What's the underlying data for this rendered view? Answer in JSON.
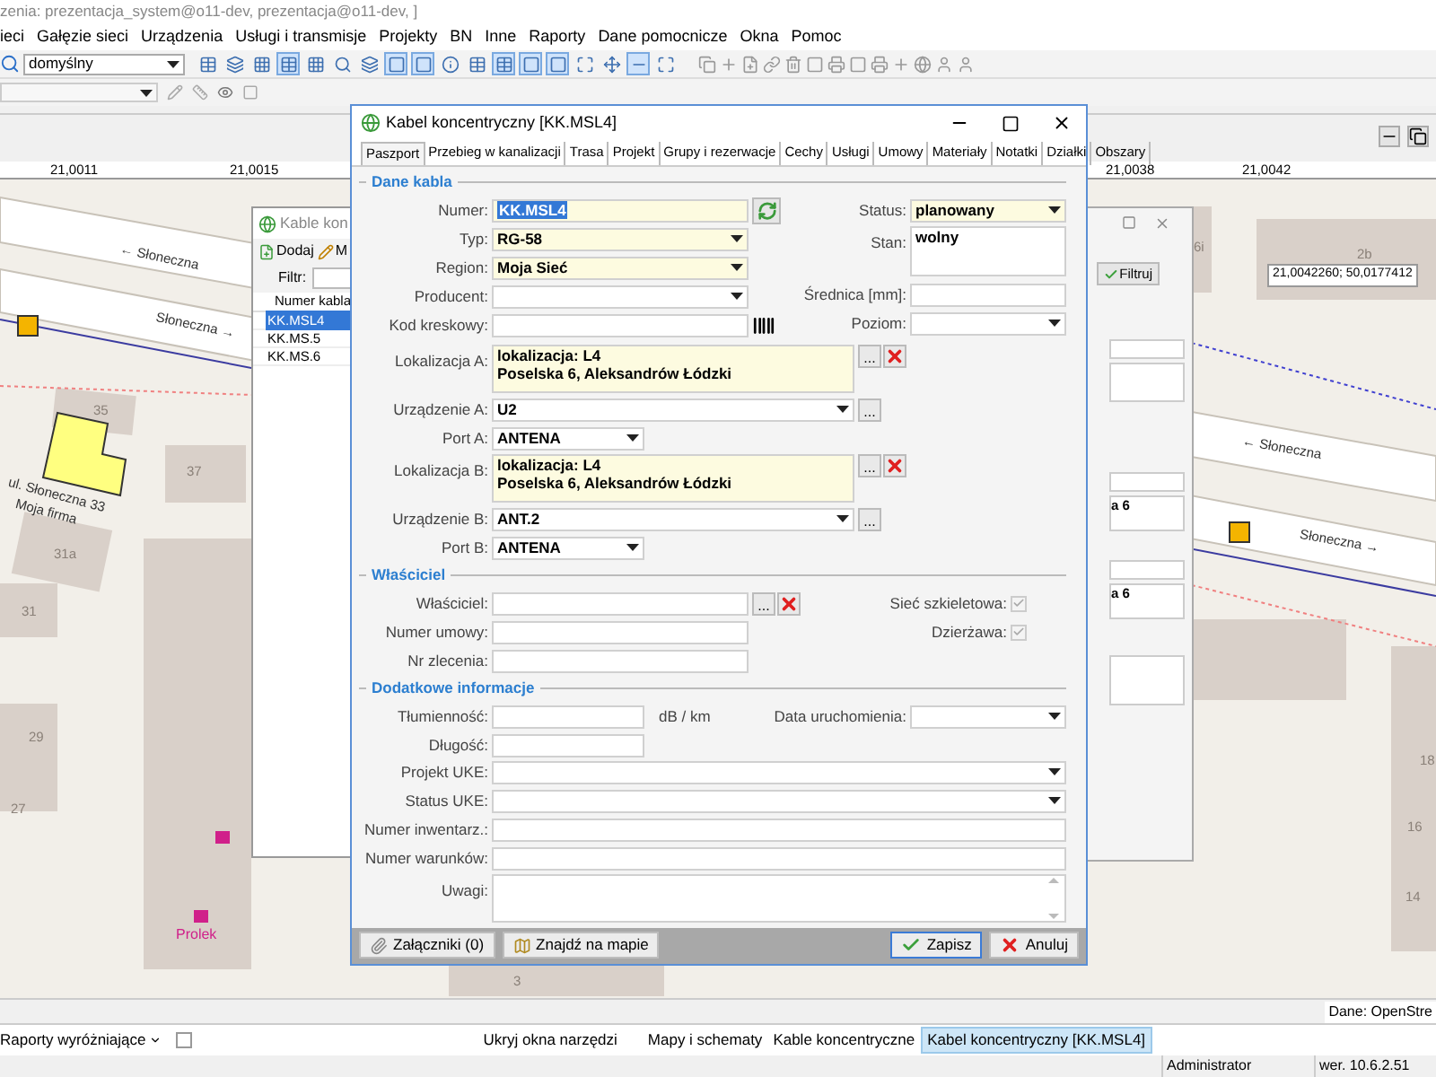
{
  "app_title": "zenia: prezentacja_system@o11-dev, prezentacja@o11-dev, ]",
  "menu": [
    "ieci",
    "Gałęzie sieci",
    "Urządzenia",
    "Usługi i transmisje",
    "Projekty",
    "BN",
    "Inne",
    "Raporty",
    "Dane pomocnicze",
    "Okna",
    "Pomoc"
  ],
  "toolbar": {
    "combo": "domyślny",
    "buttons": [
      {
        "selected": false
      },
      {
        "selected": false
      },
      {
        "selected": false
      },
      {
        "selected": true
      },
      {
        "selected": false
      },
      {
        "selected": false
      },
      {
        "selected": false
      },
      {
        "selected": true
      },
      {
        "selected": true
      },
      {
        "selected": false
      },
      {
        "selected": false
      },
      {
        "selected": true
      },
      {
        "selected": true
      },
      {
        "selected": true
      },
      {
        "selected": false
      },
      {
        "selected": false
      },
      {
        "selected": true
      },
      {
        "selected": false
      }
    ]
  },
  "ruler": [
    "21,0011",
    "21,0015",
    "21,0038",
    "21,0042"
  ],
  "map_labels": [
    {
      "text": "← Słoneczna",
      "kind": "street"
    },
    {
      "text": "Słoneczna →",
      "kind": "street"
    },
    {
      "text": "ul. Słoneczna 33",
      "kind": "address"
    },
    {
      "text": "Moja firma",
      "kind": "address"
    },
    {
      "text": "35",
      "kind": "building"
    },
    {
      "text": "37",
      "kind": "building"
    },
    {
      "text": "31a",
      "kind": "building"
    },
    {
      "text": "31",
      "kind": "building"
    },
    {
      "text": "29",
      "kind": "building"
    },
    {
      "text": "27",
      "kind": "building"
    },
    {
      "text": "Prolek",
      "kind": "poi"
    },
    {
      "text": "3",
      "kind": "building"
    },
    {
      "text": "6i",
      "kind": "building"
    },
    {
      "text": "2b",
      "kind": "building"
    },
    {
      "text": "← Słoneczna",
      "kind": "street"
    },
    {
      "text": "Słoneczna →",
      "kind": "street"
    },
    {
      "text": "18",
      "kind": "building"
    },
    {
      "text": "16",
      "kind": "building"
    },
    {
      "text": "14",
      "kind": "building"
    }
  ],
  "coordinates_tooltip": "21,0042260; 50,0177412",
  "cable_list_window": {
    "title": "Kable kon",
    "buttons": [
      "Dodaj",
      "M"
    ],
    "filter_label": "Filtr:",
    "column": "Numer kabla",
    "rows": [
      {
        "text": "KK.MSL4",
        "selected": true
      },
      {
        "text": "KK.MS.5",
        "selected": false
      },
      {
        "text": "KK.MS.6",
        "selected": false
      }
    ]
  },
  "detail_window": {
    "filter_button": "Filtruj",
    "texts": [
      "a 6",
      "a 6"
    ]
  },
  "dialog": {
    "title": "Kabel koncentryczny [KK.MSL4]",
    "tabs": [
      {
        "label": "Paszport",
        "selected": true
      },
      {
        "label": "Przebieg w kanalizacji",
        "selected": false
      },
      {
        "label": "Trasa",
        "selected": false
      },
      {
        "label": "Projekt",
        "selected": false
      },
      {
        "label": "Grupy i rezerwacje",
        "selected": false
      },
      {
        "label": "Cechy",
        "selected": false
      },
      {
        "label": "Usługi",
        "selected": false
      },
      {
        "label": "Umowy",
        "selected": false
      },
      {
        "label": "Materiały",
        "selected": false
      },
      {
        "label": "Notatki",
        "selected": false
      },
      {
        "label": "Działki",
        "selected": false
      },
      {
        "label": "Obszary",
        "selected": false
      }
    ],
    "sections": [
      {
        "title": "Dane kabla",
        "left": [
          {
            "label": "Numer:",
            "kind": "text",
            "value": "KK.MSL4",
            "required": true,
            "highlighted": true,
            "actions": [
              {
                "kind": "refresh"
              }
            ]
          },
          {
            "label": "Typ:",
            "kind": "combo",
            "value": "RG-58",
            "required": true
          },
          {
            "label": "Region:",
            "kind": "combo",
            "value": "Moja Sieć",
            "required": true
          },
          {
            "label": "Producent:",
            "kind": "combo",
            "required": false
          },
          {
            "label": "Kod kreskowy:",
            "kind": "text",
            "required": false,
            "actions": [
              {
                "kind": "barcode"
              }
            ]
          }
        ],
        "right": [
          {
            "label": "Status:",
            "kind": "combo",
            "value": "planowany",
            "required": true
          },
          {
            "label": "Stan:",
            "kind": "memo",
            "value": "wolny",
            "required": false
          },
          {
            "label": "Średnica [mm]:",
            "kind": "text",
            "required": false
          },
          {
            "label": "Poziom:",
            "kind": "combo",
            "required": false
          }
        ],
        "rows": [
          {
            "label": "Lokalizacja A:",
            "kind": "wide-memo",
            "value": "lokalizacja: L4\nPoselska 6, Aleksandrów Łódzki",
            "required": true,
            "actions": [
              {
                "kind": "browse",
                "label": "..."
              },
              {
                "kind": "clear"
              }
            ]
          },
          {
            "label": "Urządzenie A:",
            "kind": "wide-combo",
            "value": "U2",
            "required": false,
            "actions": [
              {
                "kind": "browse",
                "label": "..."
              }
            ]
          },
          {
            "label": "Port A:",
            "kind": "short-combo",
            "value": "ANTENA",
            "required": false
          },
          {
            "label": "Lokalizacja B:",
            "kind": "wide-memo",
            "value": "lokalizacja: L4\nPoselska 6, Aleksandrów Łódzki",
            "required": true,
            "actions": [
              {
                "kind": "browse",
                "label": "..."
              },
              {
                "kind": "clear"
              }
            ]
          },
          {
            "label": "Urządzenie B:",
            "kind": "wide-combo",
            "value": "ANT.2",
            "required": false,
            "actions": [
              {
                "kind": "browse",
                "label": "..."
              }
            ]
          },
          {
            "label": "Port B:",
            "kind": "short-combo",
            "value": "ANTENA",
            "required": false
          }
        ]
      },
      {
        "title": "Właściciel",
        "left": [
          {
            "label": "Właściciel:",
            "kind": "text",
            "required": false,
            "actions": [
              {
                "kind": "browse",
                "label": "..."
              },
              {
                "kind": "clear"
              }
            ]
          },
          {
            "label": "Numer umowy:",
            "kind": "text",
            "required": false
          },
          {
            "label": "Nr zlecenia:",
            "kind": "text",
            "required": false
          }
        ],
        "right": [
          {
            "label": "Sieć szkieletowa:",
            "kind": "check",
            "checked": true,
            "disabled": true
          },
          {
            "label": "Dzierżawa:",
            "kind": "check",
            "checked": true,
            "disabled": true
          }
        ]
      },
      {
        "title": "Dodatkowe informacje",
        "left": [
          {
            "label": "Tłumienność:",
            "kind": "short-text",
            "unit": "dB / km",
            "required": false
          },
          {
            "label": "Długość:",
            "kind": "short-text",
            "required": false
          }
        ],
        "right": [
          {
            "label": "Data uruchomienia:",
            "kind": "combo",
            "required": false
          }
        ],
        "rows": [
          {
            "label": "Projekt UKE:",
            "kind": "full-combo",
            "required": false
          },
          {
            "label": "Status UKE:",
            "kind": "full-combo",
            "required": false
          },
          {
            "label": "Numer inwentarz.:",
            "kind": "full-text",
            "required": false
          },
          {
            "label": "Numer warunków:",
            "kind": "full-text",
            "required": false
          },
          {
            "label": "Uwagi:",
            "kind": "full-memo",
            "required": false
          }
        ]
      }
    ],
    "footer_buttons": [
      {
        "label": "Załączniki (0)",
        "kind": "attach",
        "default": false
      },
      {
        "label": "Znajdź na mapie",
        "kind": "map",
        "default": false
      },
      {
        "label": "Zapisz",
        "kind": "save",
        "default": true
      },
      {
        "label": "Anuluj",
        "kind": "cancel",
        "default": false
      }
    ]
  },
  "map_source": "Dane: OpenStre",
  "bottom_bar": {
    "reports": "Raporty wyróżniające",
    "show_checked": false,
    "hide_tools": "Ukryj okna narzędzi",
    "tabs": [
      {
        "label": "Mapy i schematy",
        "selected": false
      },
      {
        "label": "Kable koncentryczne",
        "selected": false
      },
      {
        "label": "Kabel koncentryczny [KK.MSL4]",
        "selected": true
      }
    ]
  },
  "status_bar": [
    "Administrator",
    "wer. 10.6.2.51"
  ]
}
